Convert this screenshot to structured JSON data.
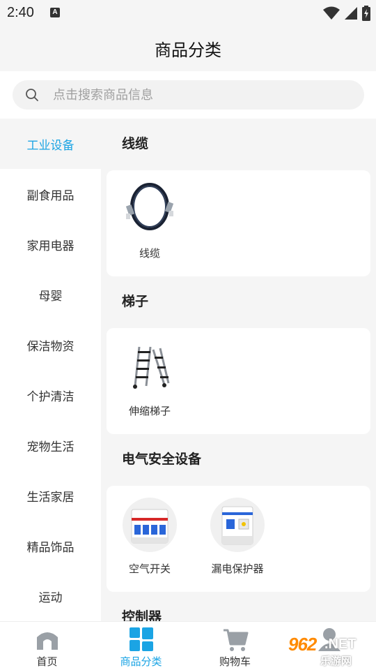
{
  "status_bar": {
    "time": "2:40",
    "notification_badge": "A"
  },
  "header": {
    "title": "商品分类"
  },
  "search": {
    "placeholder": "点击搜索商品信息"
  },
  "sidebar": {
    "items": [
      {
        "label": "工业设备",
        "active": true
      },
      {
        "label": "副食用品",
        "active": false
      },
      {
        "label": "家用电器",
        "active": false
      },
      {
        "label": "母婴",
        "active": false
      },
      {
        "label": "保洁物资",
        "active": false
      },
      {
        "label": "个护清洁",
        "active": false
      },
      {
        "label": "宠物生活",
        "active": false
      },
      {
        "label": "生活家居",
        "active": false
      },
      {
        "label": "精品饰品",
        "active": false
      },
      {
        "label": "运动",
        "active": false
      }
    ]
  },
  "categories": [
    {
      "title": "线缆",
      "products": [
        {
          "name": "线缆",
          "icon": "cable-icon"
        }
      ]
    },
    {
      "title": "梯子",
      "products": [
        {
          "name": "伸缩梯子",
          "icon": "ladder-icon"
        }
      ]
    },
    {
      "title": "电气安全设备",
      "products": [
        {
          "name": "空气开关",
          "icon": "air-switch-icon"
        },
        {
          "name": "漏电保护器",
          "icon": "leakage-protector-icon"
        }
      ]
    },
    {
      "title": "控制器",
      "products": []
    }
  ],
  "tabbar": {
    "tabs": [
      {
        "label": "首页",
        "icon": "home-icon",
        "active": false
      },
      {
        "label": "商品分类",
        "icon": "category-icon",
        "active": true
      },
      {
        "label": "购物车",
        "icon": "cart-icon",
        "active": false
      },
      {
        "label": "",
        "icon": "profile-icon",
        "active": false
      }
    ]
  },
  "watermark": {
    "number": "962",
    "domain": ".NET",
    "subtitle": "乐游网"
  },
  "colors": {
    "accent": "#1ba4e4",
    "background": "#f5f5f5",
    "card": "#ffffff"
  }
}
